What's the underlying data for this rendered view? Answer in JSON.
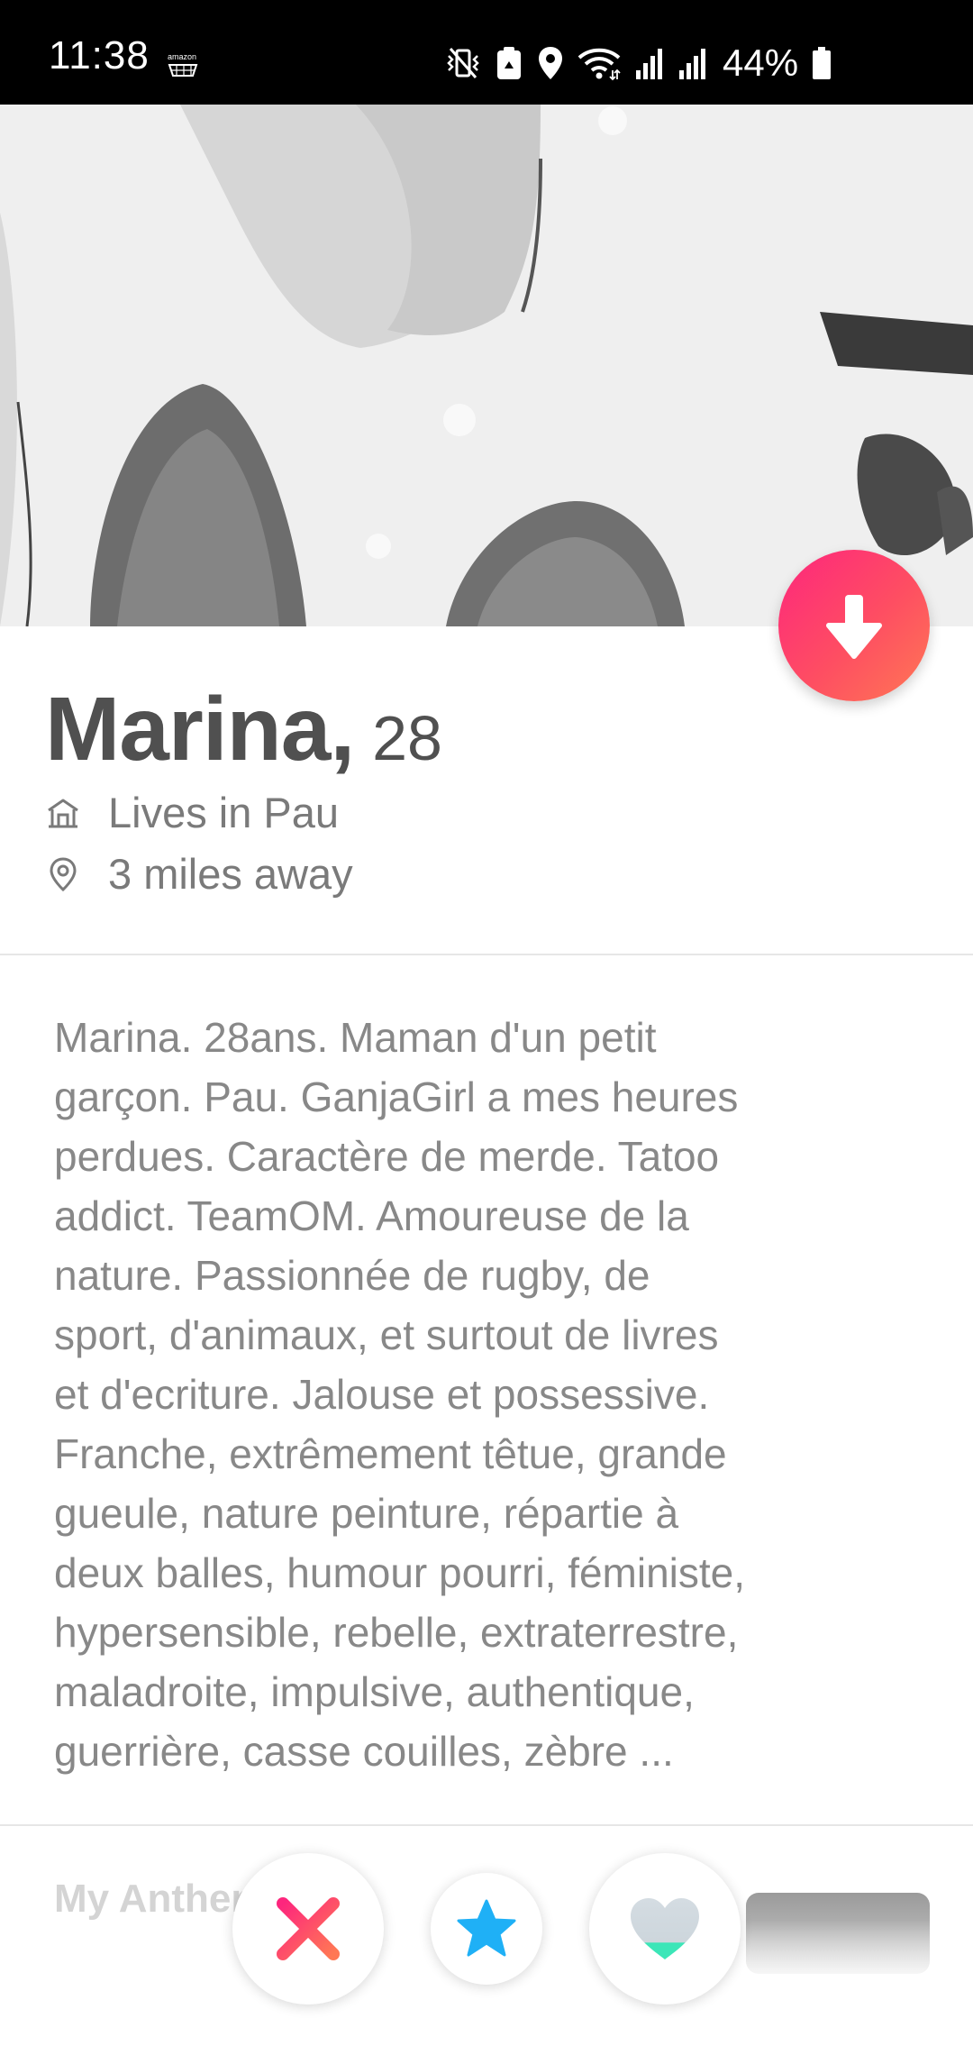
{
  "status_bar": {
    "time": "11:38",
    "amazon_label": "amazon",
    "battery": "44%",
    "icons": [
      "amazon-cart-icon",
      "mute-vibrate-icon",
      "recycle-icon",
      "location-icon",
      "wifi-icon",
      "signal-1-icon",
      "signal-2-icon",
      "battery-icon"
    ]
  },
  "profile": {
    "name": "Marina,",
    "age": "28",
    "lives_in": "Lives in Pau",
    "distance": "3 miles away",
    "bio": "Marina. 28ans. Maman d'un petit\ngarçon. Pau. GanjaGirl a mes heures\nperdues. Caractère de merde. Tatoo\naddict. TeamOM. Amoureuse de la\nnature. Passionnée de rugby, de\nsport, d'animaux, et surtout de livres\net d'ecriture. Jalouse et possessive.\nFranche, extrêmement têtue, grande\ngueule, nature peinture, répartie à\ndeux balles, humour pourri, féministe,\nhypersensible, rebelle, extraterrestre,\nmaladroite, impulsive, authentique,\nguerrière, casse couilles, zèbre ..."
  },
  "anthem": {
    "title": "My Anthem"
  },
  "actions": {
    "expand_icon": "arrow-down-icon",
    "nope_icon": "close-x-icon",
    "superlike_icon": "star-icon",
    "like_icon": "heart-icon"
  },
  "colors": {
    "brand_gradient": [
      "#fd267d",
      "#ff7854"
    ],
    "nope_gradient": [
      "#fd267d",
      "#ff7854"
    ],
    "superlike_blue": "#1fb0f6",
    "like_disabled": "#cdd6dc",
    "like_teal": "#3ce6b8",
    "name_text": "#505050",
    "secondary_text": "#7a7a7a",
    "bio_text": "#888888"
  }
}
